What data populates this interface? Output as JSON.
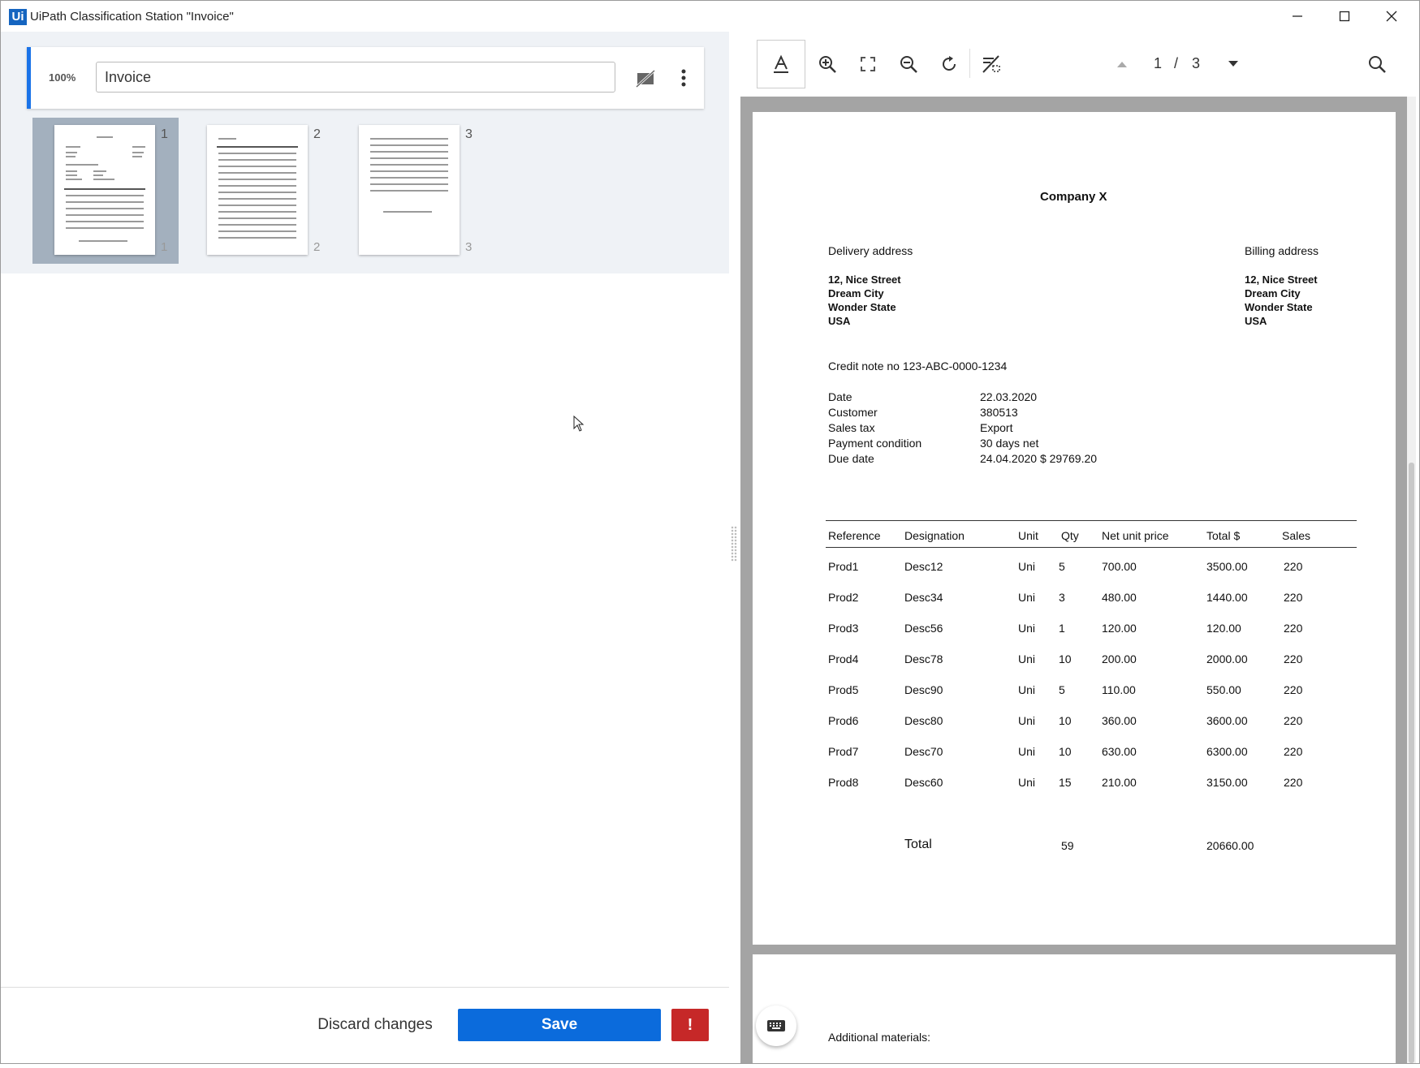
{
  "window": {
    "logo": "Ui",
    "title": "UiPath Classification Station \"Invoice\"",
    "controls": [
      "minimize-icon",
      "maximize-icon",
      "close-icon"
    ]
  },
  "classification": {
    "confidence": "100%",
    "doc_type": "Invoice",
    "icons": [
      "hide-icon",
      "more-vert-icon"
    ],
    "thumbnails": [
      {
        "top": "1",
        "bottom": "1",
        "selected": true
      },
      {
        "top": "2",
        "bottom": "2",
        "selected": false
      },
      {
        "top": "3",
        "bottom": "3",
        "selected": false
      }
    ]
  },
  "actions": {
    "discard": "Discard changes",
    "save": "Save",
    "warn": "!"
  },
  "viewer_toolbar": {
    "icons": [
      "text-select-icon",
      "zoom-in-icon",
      "fit-page-icon",
      "zoom-out-icon",
      "rotate-icon",
      "toggle-highlight-icon",
      "prev-page-icon",
      "next-page-icon",
      "search-icon"
    ],
    "current_page": "1",
    "separator": "/",
    "total_pages": "3"
  },
  "document": {
    "company": "Company X",
    "delivery_label": "Delivery address",
    "billing_label": "Billing address",
    "delivery_lines": [
      "12, Nice Street",
      "Dream City",
      "Wonder State",
      "USA"
    ],
    "billing_lines": [
      "12, Nice Street",
      "Dream City",
      "Wonder State",
      "USA"
    ],
    "credit_note": "Credit note no 123-ABC-0000-1234",
    "meta": [
      {
        "label": "Date",
        "value": "22.03.2020"
      },
      {
        "label": "Customer",
        "value": "380513"
      },
      {
        "label": "Sales tax",
        "value": "Export"
      },
      {
        "label": "Payment condition",
        "value": "30 days net"
      },
      {
        "label": "Due date",
        "value": "24.04.2020 $ 29769.20"
      }
    ],
    "table": {
      "headers": [
        "Reference",
        "Designation",
        "Unit",
        "Qty",
        "Net unit price",
        "Total $",
        "Sales"
      ],
      "rows": [
        [
          "Prod1",
          "Desc12",
          "Uni",
          "5",
          "700.00",
          "3500.00",
          "220"
        ],
        [
          "Prod2",
          "Desc34",
          "Uni",
          "3",
          "480.00",
          "1440.00",
          "220"
        ],
        [
          "Prod3",
          "Desc56",
          "Uni",
          "1",
          "120.00",
          "120.00",
          "220"
        ],
        [
          "Prod4",
          "Desc78",
          "Uni",
          "10",
          "200.00",
          "2000.00",
          "220"
        ],
        [
          "Prod5",
          "Desc90",
          "Uni",
          "5",
          "110.00",
          "550.00",
          "220"
        ],
        [
          "Prod6",
          "Desc80",
          "Uni",
          "10",
          "360.00",
          "3600.00",
          "220"
        ],
        [
          "Prod7",
          "Desc70",
          "Uni",
          "10",
          "630.00",
          "6300.00",
          "220"
        ],
        [
          "Prod8",
          "Desc60",
          "Uni",
          "15",
          "210.00",
          "3150.00",
          "220"
        ]
      ],
      "total_label": "Total",
      "total_qty": "59",
      "total_amount": "20660.00"
    },
    "page2_text": "Additional materials:"
  },
  "keyboard_icon": "keyboard-icon"
}
